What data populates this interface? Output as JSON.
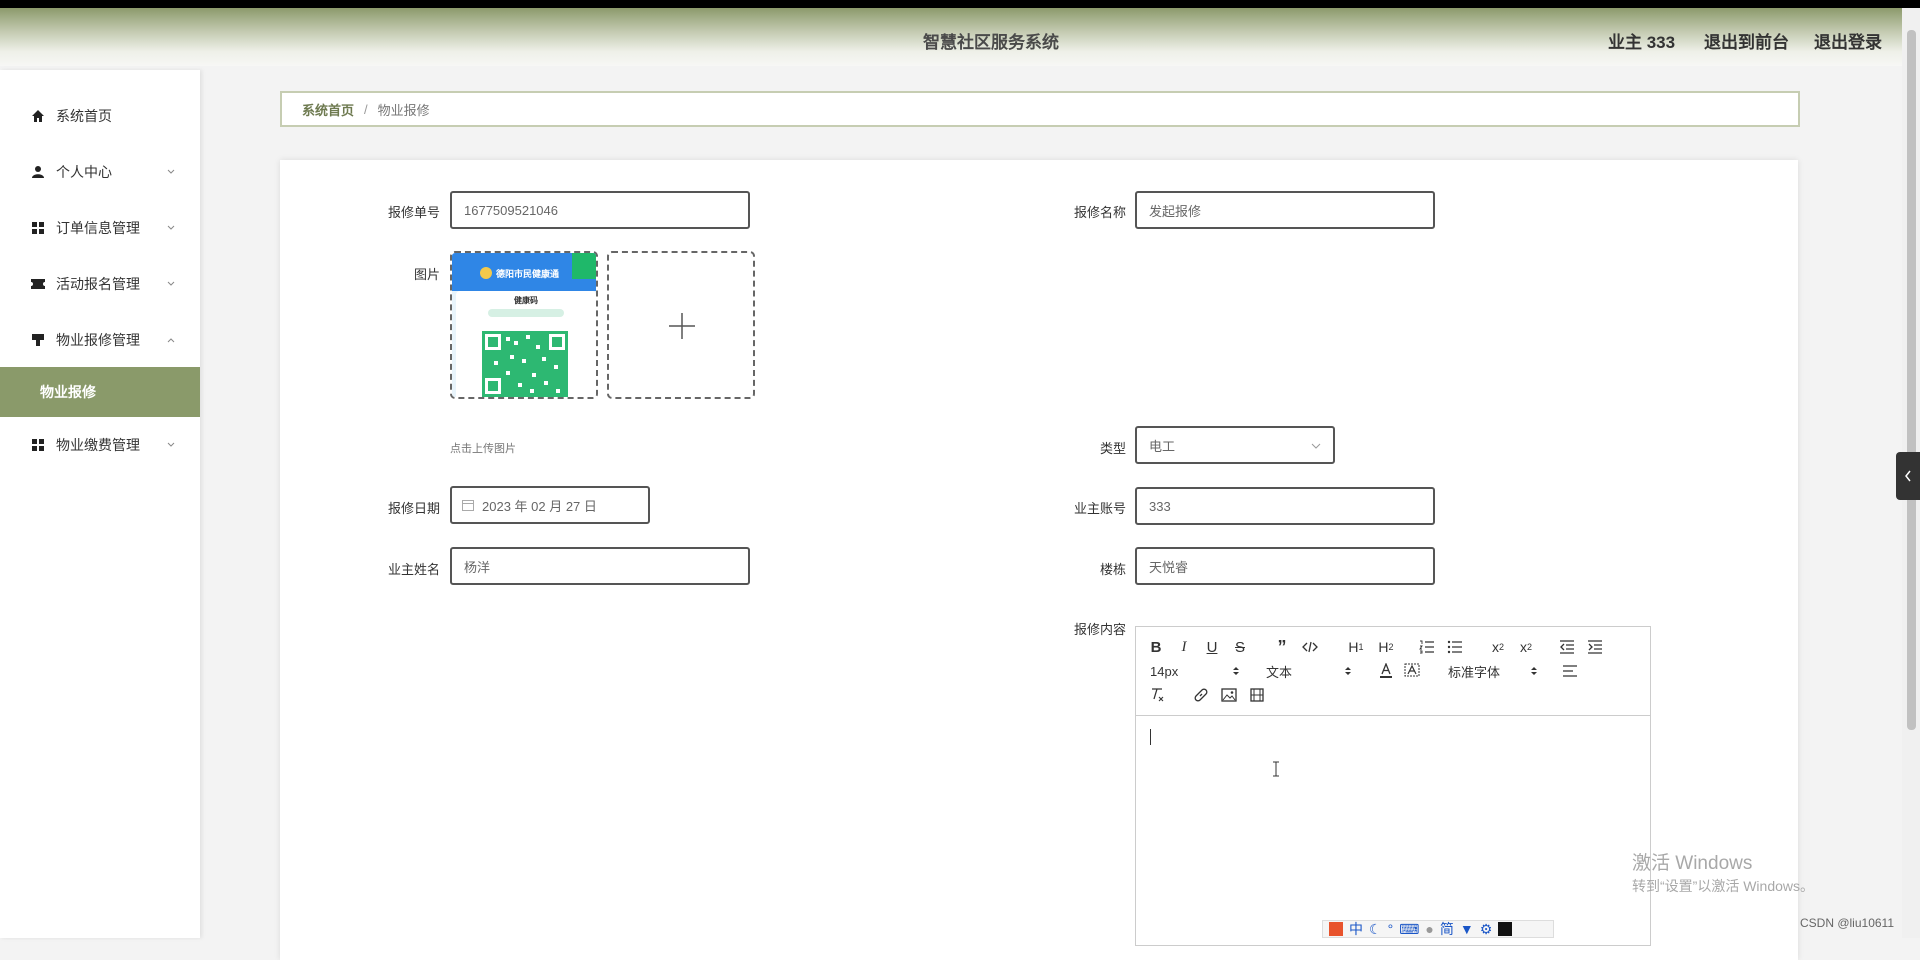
{
  "header": {
    "title": "智慧社区服务系统",
    "user": "业主 333",
    "front": "退出到前台",
    "logout": "退出登录"
  },
  "sidebar": {
    "items": [
      {
        "label": "系统首页",
        "icon": "home-icon"
      },
      {
        "label": "个人中心",
        "icon": "user-icon"
      },
      {
        "label": "订单信息管理",
        "icon": "grid-icon"
      },
      {
        "label": "活动报名管理",
        "icon": "ticket-icon"
      },
      {
        "label": "物业报修管理",
        "icon": "brush-icon"
      },
      {
        "label": "物业缴费管理",
        "icon": "grid-icon"
      }
    ],
    "active_sub": "物业报修"
  },
  "breadcrumb": {
    "home": "系统首页",
    "sep": "/",
    "current": "物业报修"
  },
  "form": {
    "order_no": {
      "label": "报修单号",
      "value": "1677509521046"
    },
    "name": {
      "label": "报修名称",
      "value": "发起报修"
    },
    "image": {
      "label": "图片",
      "hint": "点击上传图片",
      "thumb_title": "德阳市民健康通",
      "thumb_sub": "健康码"
    },
    "type": {
      "label": "类型",
      "value": "电工"
    },
    "date": {
      "label": "报修日期",
      "value": "2023 年 02 月 27 日"
    },
    "account": {
      "label": "业主账号",
      "value": "333"
    },
    "owner": {
      "label": "业主姓名",
      "value": "杨洋"
    },
    "building": {
      "label": "楼栋",
      "value": "天悦睿"
    },
    "content": {
      "label": "报修内容"
    }
  },
  "editor": {
    "font_size": "14px",
    "paragraph": "文本",
    "font_family": "标准字体"
  },
  "overlay": {
    "watermark_line1": "激活 Windows",
    "watermark_line2": "转到“设置”以激活 Windows。",
    "csdn": "CSDN @liu10611",
    "ime": [
      "中",
      "简"
    ]
  },
  "colors": {
    "accent": "#8a9a6a",
    "header": "#8c9a6c"
  }
}
